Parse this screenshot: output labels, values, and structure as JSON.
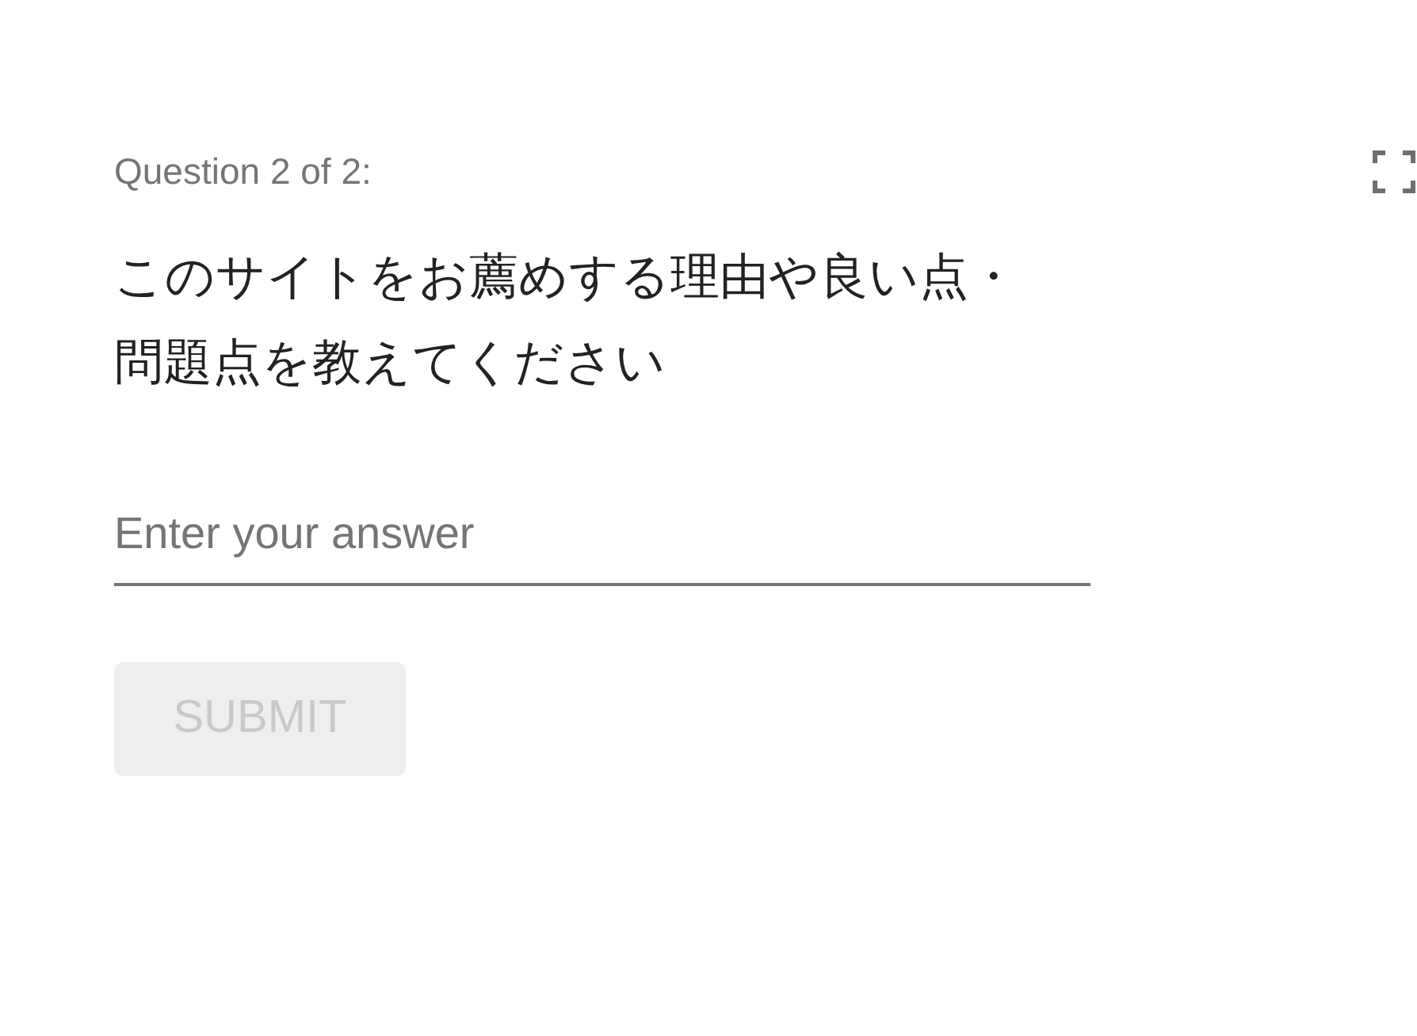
{
  "question": {
    "counter": "Question 2 of 2:",
    "text": "このサイトをお薦めする理由や良い点・問題点を教えてください"
  },
  "answer": {
    "placeholder": "Enter your answer"
  },
  "submit": {
    "label": "SUBMIT",
    "disabled": true
  }
}
